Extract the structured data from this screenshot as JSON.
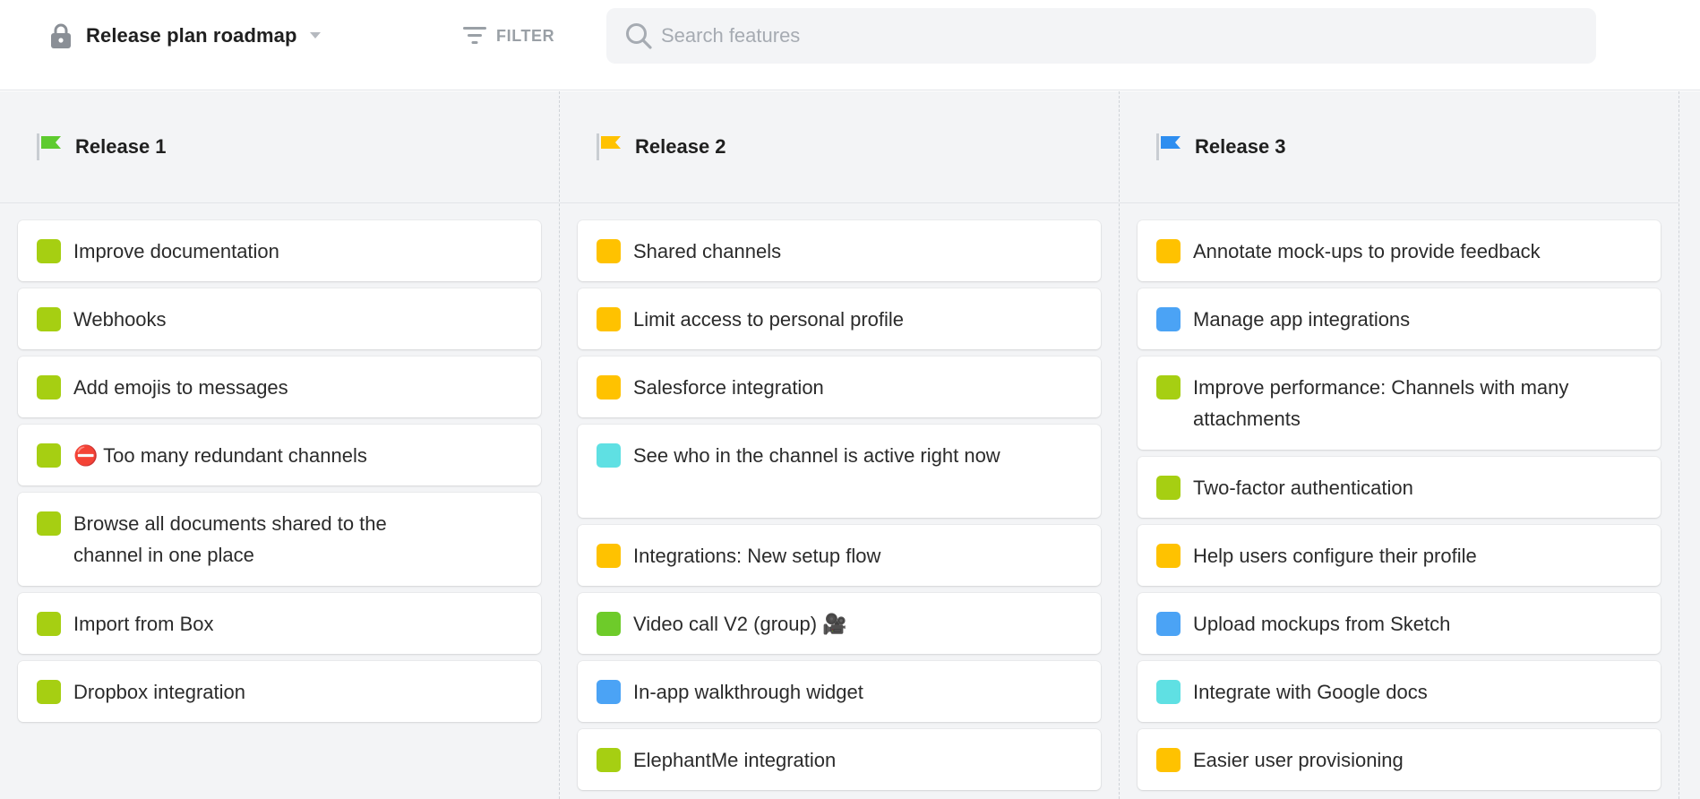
{
  "header": {
    "title": "Release plan roadmap",
    "filter_label": "FILTER",
    "search_placeholder": "Search features"
  },
  "colors": {
    "green": "#a6cf12",
    "yellow": "#ffc200",
    "blue": "#4ba3f5",
    "teal": "#5fe0e3",
    "bright_green": "#6ecb2a"
  },
  "columns": [
    {
      "title": "Release 1",
      "flag_color": "#5ecb2f",
      "cards": [
        {
          "label": "Improve documentation",
          "color": "#a6cf12"
        },
        {
          "label": "Webhooks",
          "color": "#a6cf12"
        },
        {
          "label": "Add emojis to messages",
          "color": "#a6cf12"
        },
        {
          "label": "⛔ Too many redundant channels",
          "color": "#a6cf12"
        },
        {
          "label": "Browse all documents shared to the channel in one place",
          "color": "#a6cf12"
        },
        {
          "label": "Import from Box",
          "color": "#a6cf12"
        },
        {
          "label": "Dropbox integration",
          "color": "#a6cf12"
        }
      ]
    },
    {
      "title": "Release 2",
      "flag_color": "#ffc200",
      "cards": [
        {
          "label": "Shared channels",
          "color": "#ffc200"
        },
        {
          "label": "Limit access to personal profile",
          "color": "#ffc200"
        },
        {
          "label": "Salesforce integration",
          "color": "#ffc200"
        },
        {
          "label": "See who in the channel is active right now",
          "color": "#5fe0e3"
        },
        {
          "label": "Integrations: New setup flow",
          "color": "#ffc200"
        },
        {
          "label": "Video call V2 (group) 🎥",
          "color": "#6ecb2a"
        },
        {
          "label": "In-app walkthrough widget",
          "color": "#4ba3f5"
        },
        {
          "label": "ElephantMe integration",
          "color": "#a6cf12"
        }
      ]
    },
    {
      "title": "Release 3",
      "flag_color": "#2e8ef0",
      "cards": [
        {
          "label": "Annotate mock-ups to provide feedback",
          "color": "#ffc200"
        },
        {
          "label": "Manage app integrations",
          "color": "#4ba3f5"
        },
        {
          "label": "Improve performance: Channels with many attachments",
          "color": "#a6cf12"
        },
        {
          "label": "Two-factor authentication",
          "color": "#a6cf12"
        },
        {
          "label": "Help users configure their profile",
          "color": "#ffc200"
        },
        {
          "label": "Upload mockups from Sketch",
          "color": "#4ba3f5"
        },
        {
          "label": "Integrate with Google docs",
          "color": "#5fe0e3"
        },
        {
          "label": "Easier user provisioning",
          "color": "#ffc200"
        }
      ]
    }
  ]
}
